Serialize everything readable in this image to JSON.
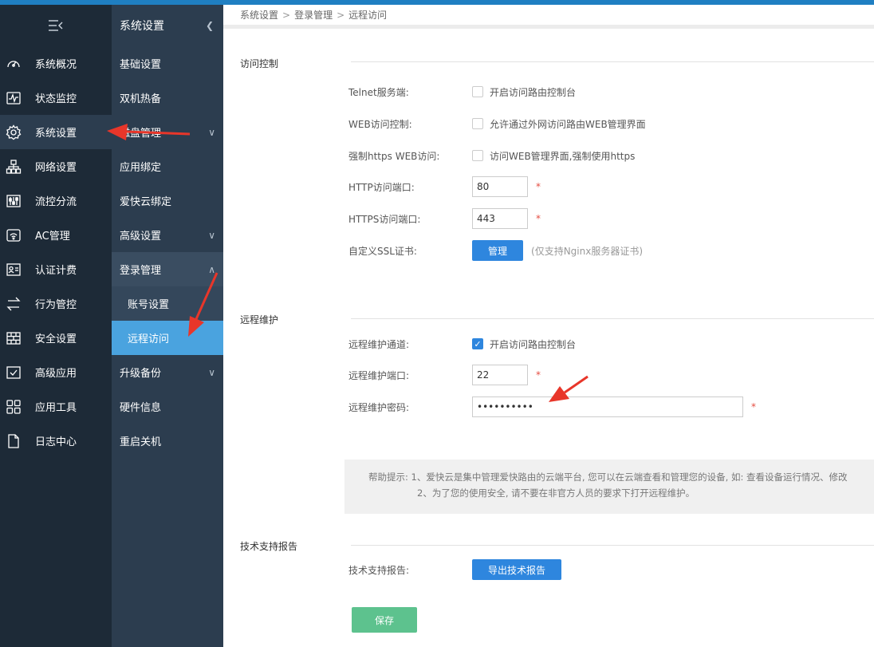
{
  "nav1": {
    "toggle_icon": "collapse-menu-icon",
    "items": [
      {
        "label": "系统概况",
        "icon": "dashboard-gauge-icon"
      },
      {
        "label": "状态监控",
        "icon": "monitor-pulse-icon"
      },
      {
        "label": "系统设置",
        "icon": "gear-icon"
      },
      {
        "label": "网络设置",
        "icon": "network-topology-icon"
      },
      {
        "label": "流控分流",
        "icon": "sliders-icon"
      },
      {
        "label": "AC管理",
        "icon": "wifi-router-icon"
      },
      {
        "label": "认证计费",
        "icon": "id-card-icon"
      },
      {
        "label": "行为管控",
        "icon": "swap-arrows-icon"
      },
      {
        "label": "安全设置",
        "icon": "firewall-icon"
      },
      {
        "label": "高级应用",
        "icon": "checklist-icon"
      },
      {
        "label": "应用工具",
        "icon": "apps-grid-icon"
      },
      {
        "label": "日志中心",
        "icon": "document-icon"
      }
    ]
  },
  "nav2": {
    "title": "系统设置",
    "items": [
      "基础设置",
      "双机热备",
      "磁盘管理",
      "应用绑定",
      "爱快云绑定",
      "高级设置",
      "登录管理"
    ],
    "subitems": [
      "账号设置",
      "远程访问"
    ],
    "items_after": [
      "升级备份",
      "硬件信息",
      "重启关机"
    ]
  },
  "breadcrumb": [
    "系统设置",
    "登录管理",
    "远程访问"
  ],
  "access": {
    "title": "访问控制",
    "telnet_label": "Telnet服务端:",
    "telnet_text": "开启访问路由控制台",
    "web_label": "WEB访问控制:",
    "web_text": "允许通过外网访问路由WEB管理界面",
    "https_label": "强制https WEB访问:",
    "https_text": "访问WEB管理界面,强制使用https",
    "http_port_label": "HTTP访问端口:",
    "http_port": "80",
    "https_port_label": "HTTPS访问端口:",
    "https_port": "443",
    "ssl_label": "自定义SSL证书:",
    "ssl_button": "管理",
    "ssl_hint": "(仅支持Nginx服务器证书)",
    "required": "*"
  },
  "remote": {
    "title": "远程维护",
    "channel_label": "远程维护通道:",
    "channel_text": "开启访问路由控制台",
    "port_label": "远程维护端口:",
    "port": "22",
    "password_label": "远程维护密码:",
    "password": "••••••••••"
  },
  "help": {
    "line1": "帮助提示: 1、爱快云是集中管理爱快路由的云端平台, 您可以在云端查看和管理您的设备, 如: 查看设备运行情况、修改",
    "line2": "2、为了您的使用安全, 请不要在非官方人员的要求下打开远程维护。"
  },
  "support": {
    "title": "技术支持报告",
    "label": "技术支持报告:",
    "button": "导出技术报告"
  },
  "save_label": "保存",
  "colors": {
    "nav1_bg": "#1d2a37",
    "nav2_bg": "#2c3d4f",
    "accent": "#2e86de",
    "active_sub": "#4aa3df",
    "save": "#5dc28e",
    "annotation_arrow": "#e8362a"
  }
}
